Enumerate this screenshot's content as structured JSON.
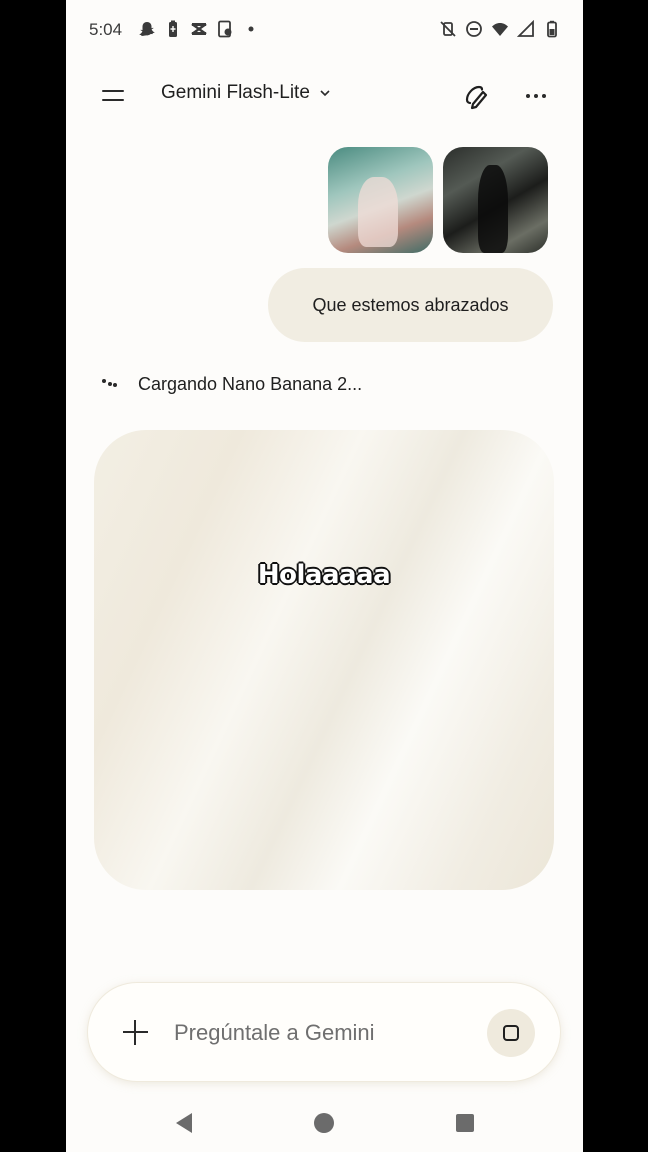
{
  "status_bar": {
    "time": "5:04",
    "left_icons": [
      "snapchat-icon",
      "battery-saver-icon",
      "capcut-icon",
      "screen-record-icon",
      "dot-icon"
    ],
    "right_icons": [
      "vibrate-off-icon",
      "do-not-disturb-icon",
      "wifi-icon",
      "signal-icon",
      "battery-icon"
    ]
  },
  "top_bar": {
    "model_name": "Gemini Flash-Lite"
  },
  "attachments": [
    {
      "icon": "image-thumbnail"
    },
    {
      "icon": "image-thumbnail"
    }
  ],
  "user_message": {
    "text": "Que estemos abrazados"
  },
  "loading": {
    "text": "Cargando Nano Banana 2..."
  },
  "image_placeholder": {
    "overlay_text": "Holaaaaa"
  },
  "input_bar": {
    "placeholder": "Pregúntale a Gemini"
  },
  "colors": {
    "background": "#fdfcfa",
    "bubble": "#f1ede2",
    "placeholder_card": "#f1ede3",
    "stop_button": "#efeadd"
  }
}
